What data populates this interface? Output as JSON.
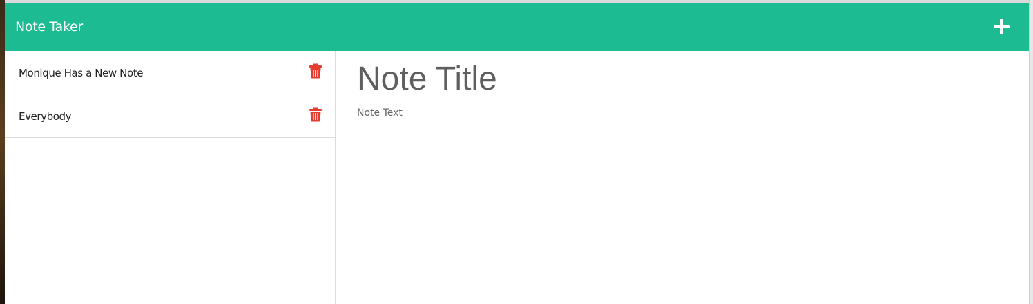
{
  "app": {
    "brand": "Note Taker",
    "accent_color": "#1cbb91",
    "delete_color": "#e43d2f"
  },
  "toolbar": {
    "new_note_icon": "plus-icon"
  },
  "notes": [
    {
      "title": "Monique Has a New Note",
      "icon": "trash-icon"
    },
    {
      "title": "Everybody",
      "icon": "trash-icon"
    }
  ],
  "editor": {
    "title_placeholder": "Note Title",
    "text_placeholder": "Note Text"
  }
}
